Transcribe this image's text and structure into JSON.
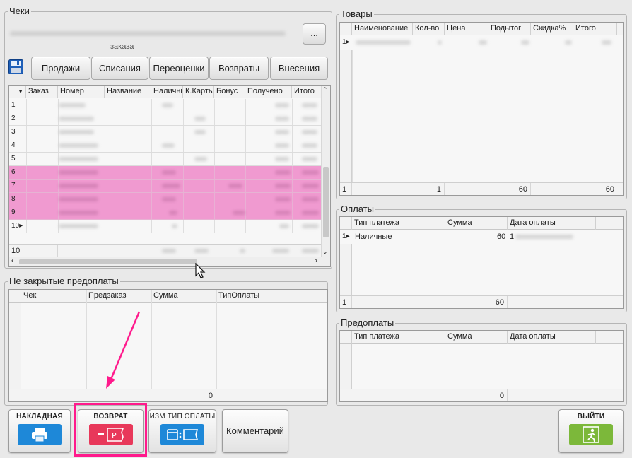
{
  "checks": {
    "title": "Чеки",
    "summary_suffix": "заказа",
    "more_button": "...",
    "tabs": [
      "Продажи",
      "Списания",
      "Переоценки",
      "Возвраты",
      "Внесения"
    ],
    "columns": [
      "Заказ",
      "Номер",
      "Название",
      "Наличні",
      "К.Карть",
      "Бонус",
      "Получено",
      "Итого"
    ],
    "rows": [
      {
        "n": "1",
        "hl": false
      },
      {
        "n": "2",
        "hl": false
      },
      {
        "n": "3",
        "hl": false
      },
      {
        "n": "4",
        "hl": false
      },
      {
        "n": "5",
        "hl": false
      },
      {
        "n": "6",
        "hl": true
      },
      {
        "n": "7",
        "hl": true
      },
      {
        "n": "8",
        "hl": true
      },
      {
        "n": "9",
        "hl": true
      },
      {
        "n": "10",
        "hl": false,
        "current": true
      }
    ],
    "footer_count": "10",
    "highlight_color": "#f09ad0"
  },
  "prepay_open": {
    "title": "Не закрытые предоплаты",
    "columns": [
      "Чек",
      "Предзаказ",
      "Сумма",
      "ТипОплаты"
    ],
    "footer_sum": "0"
  },
  "goods": {
    "title": "Товары",
    "columns": [
      "Наименование",
      "Кол-во",
      "Цена",
      "Подытог",
      "Скидка%",
      "Итого"
    ],
    "row_number": "1",
    "footer": {
      "count": "1",
      "count_label": "1",
      "subtotal": "60",
      "total": "60"
    }
  },
  "payments": {
    "title": "Оплаты",
    "columns": [
      "Тип платежа",
      "Сумма",
      "Дата оплаты"
    ],
    "rows": [
      {
        "n": "1",
        "type": "Наличные",
        "sum": "60",
        "date_prefix": "1"
      }
    ],
    "footer": {
      "count": "1",
      "sum": "60"
    }
  },
  "prepayments": {
    "title": "Предоплаты",
    "columns": [
      "Тип платежа",
      "Сумма",
      "Дата оплаты"
    ],
    "footer": {
      "sum": "0"
    }
  },
  "buttons": {
    "invoice": "НАКЛАДНАЯ",
    "refund": "ВОЗВРАТ",
    "change_payment": "ИЗМ ТИП ОПЛАТЫ",
    "comment": "Комментарий",
    "exit": "ВЫЙТИ"
  },
  "colors": {
    "accent_blue": "#1e88d8",
    "refund_red": "#e8385a",
    "exit_green": "#7cb83a",
    "annotation": "#ff1a8c"
  },
  "icons": [
    "save-icon",
    "printer-icon",
    "refund-icon",
    "payment-swap-icon",
    "exit-icon",
    "mouse-cursor-icon"
  ]
}
